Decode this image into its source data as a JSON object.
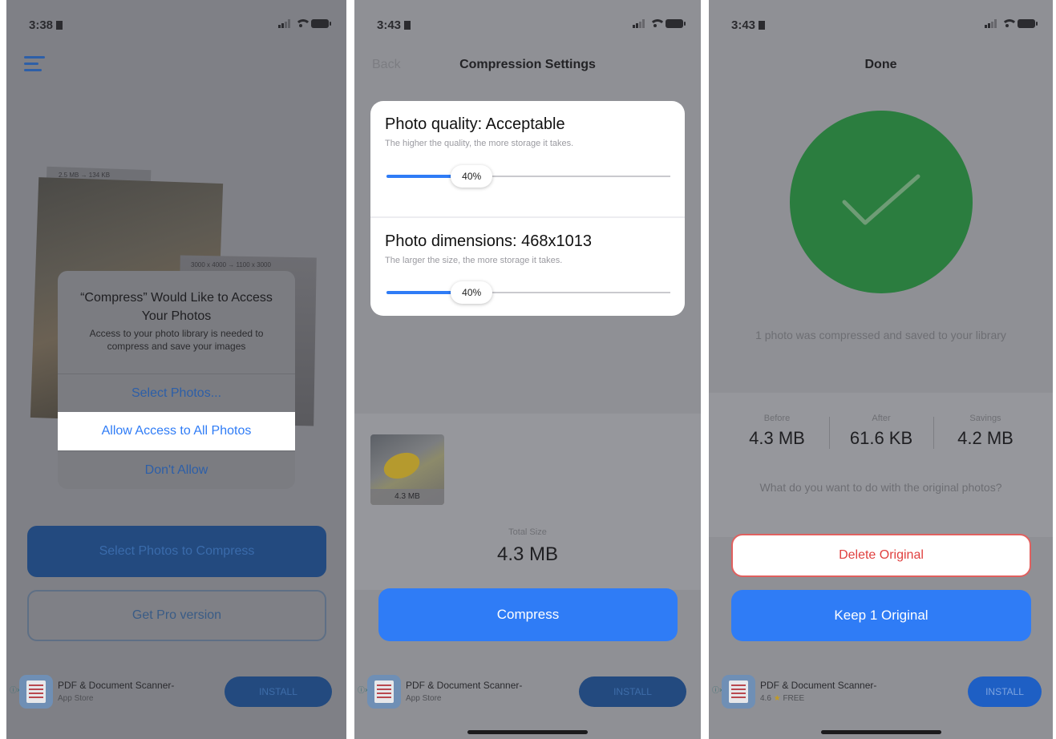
{
  "colors": {
    "accent": "#2f7cf6",
    "success": "#2b7d3f",
    "destructive": "#e0403f",
    "dim_overlay": "#8f9095"
  },
  "screen1": {
    "status_time": "3:38",
    "photo_tag_1": "2.5 MB → 134 KB",
    "photo_tag_2": "3000 x 4000 → 1100 x 3000",
    "alert": {
      "title": "“Compress” Would Like to Access Your Photos",
      "message": "Access to your photo library is needed to compress and save your images",
      "select_photos": "Select Photos...",
      "allow_all": "Allow Access to All Photos",
      "dont_allow": "Don't Allow"
    },
    "primary_button": "Select Photos to Compress",
    "pro_button": "Get Pro version",
    "ad": {
      "info": "ⓘ×",
      "name": "PDF & Document Scanner-",
      "sub": "App Store",
      "install": "INSTALL"
    }
  },
  "screen2": {
    "status_time": "3:43",
    "nav_back": "Back",
    "nav_title": "Compression Settings",
    "quality": {
      "title": "Photo quality: Acceptable",
      "subtitle": "The higher the quality, the more storage it takes.",
      "value_label": "40%",
      "value": 0.3
    },
    "dimensions": {
      "title": "Photo dimensions: 468x1013",
      "subtitle": "The larger the size, the more storage it takes.",
      "value_label": "40%",
      "value": 0.3
    },
    "thumbnail_size": "4.3 MB",
    "total_label": "Total Size",
    "total_value": "4.3 MB",
    "compress_button": "Compress",
    "ad": {
      "info": "ⓘ×",
      "name": "PDF & Document Scanner-",
      "sub": "App Store",
      "install": "INSTALL"
    }
  },
  "screen3": {
    "status_time": "3:43",
    "title": "Done",
    "message": "1 photo was compressed and saved to your library",
    "stats": [
      {
        "label": "Before",
        "value": "4.3 MB"
      },
      {
        "label": "After",
        "value": "61.6 KB"
      },
      {
        "label": "Savings",
        "value": "4.2 MB"
      }
    ],
    "question": "What do you want to do with the original photos?",
    "delete_button": "Delete Original",
    "keep_button": "Keep 1 Original",
    "ad": {
      "info": "ⓘ×",
      "name": "PDF & Document Scanner-",
      "rating": "4.6",
      "star": "★",
      "price": "FREE",
      "install": "INSTALL"
    }
  }
}
